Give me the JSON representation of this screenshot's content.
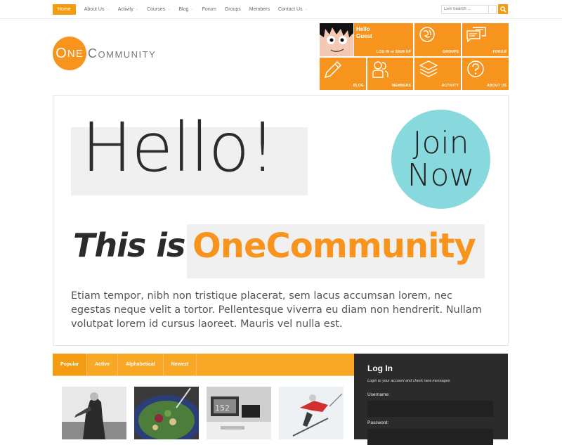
{
  "nav": {
    "items": [
      {
        "label": "Home",
        "active": true,
        "has_submenu": false
      },
      {
        "label": "About Us",
        "has_submenu": true
      },
      {
        "label": "Activity",
        "has_submenu": true
      },
      {
        "label": "Courses",
        "has_submenu": true
      },
      {
        "label": "Blog",
        "has_submenu": true
      },
      {
        "label": "Forum",
        "has_submenu": false
      },
      {
        "label": "Groups",
        "has_submenu": false
      },
      {
        "label": "Members",
        "has_submenu": false
      },
      {
        "label": "Contact Us",
        "has_submenu": true
      }
    ],
    "chevron": "⌄"
  },
  "search": {
    "placeholder": "Live Search ...",
    "arrows": "↕",
    "icon": "search-icon"
  },
  "logo": {
    "one": "One",
    "community": "Community",
    "one_cap": "O",
    "one_rest": "NE",
    "comm_cap": "C",
    "comm_rest": "OMMUNITY"
  },
  "tiles": {
    "greeting_1": "Hello",
    "greeting_2": "Guest",
    "login": "LOG IN or SIGN UP",
    "groups": "GROUPS",
    "forum": "FORUM",
    "blog": "BLOG",
    "members": "MEMBERS",
    "activity": "ACTIVITY",
    "about": "ABOUT US"
  },
  "hero": {
    "hello": "Hello!",
    "join_1": "Join",
    "join_2": "Now",
    "this_is": "This is",
    "brand": "OneCommunity",
    "paragraph": "Etiam tempor, nibh non tristique placerat, sem lacus accumsan lorem, nec egestas neque velit a tortor. Pellentesque viverra eu diam non hendrerit. Nullam volutpat lorem id cursus laoreet. Mauris vel nulla est."
  },
  "tabs": [
    "Popular",
    "Active",
    "Alphabetical",
    "Newest"
  ],
  "thumbnails": [
    "concert-photo",
    "salad-photo",
    "desk-photo",
    "skier-photo"
  ],
  "login": {
    "title": "Log In",
    "subtitle": "Login to your account and check new messages.",
    "username_label": "Username:",
    "password_label": "Password:"
  },
  "colors": {
    "accent": "#f7941d",
    "join": "#88d9de",
    "dark": "#2b2b2b"
  }
}
